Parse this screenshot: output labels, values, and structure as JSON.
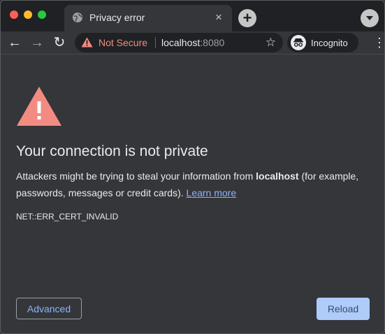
{
  "tab": {
    "title": "Privacy error",
    "close_glyph": "×"
  },
  "new_tab_glyph": "+",
  "toolbar": {
    "back_glyph": "←",
    "forward_glyph": "→",
    "reload_glyph": "↻",
    "security_label": "Not Secure",
    "url_host": "localhost",
    "url_port": ":8080",
    "star_glyph": "☆",
    "incognito_label": "Incognito",
    "menu_glyph": "⋮"
  },
  "page": {
    "heading": "Your connection is not private",
    "message_prefix": "Attackers might be trying to steal your information from ",
    "message_host": "localhost",
    "message_suffix": " (for example, passwords, messages or credit cards). ",
    "learn_more": "Learn more",
    "error_code": "NET::ERR_CERT_INVALID",
    "advanced_button": "Advanced",
    "reload_button": "Reload"
  },
  "colors": {
    "warning_red": "#f28b82",
    "link_blue": "#8ab4f8",
    "reload_bg": "#aecbfa",
    "background": "#35363a"
  },
  "icons": {
    "tab_favicon": "globe-icon",
    "security": "warning-triangle-icon",
    "page_hero": "warning-triangle-icon",
    "incognito": "incognito-icon"
  }
}
